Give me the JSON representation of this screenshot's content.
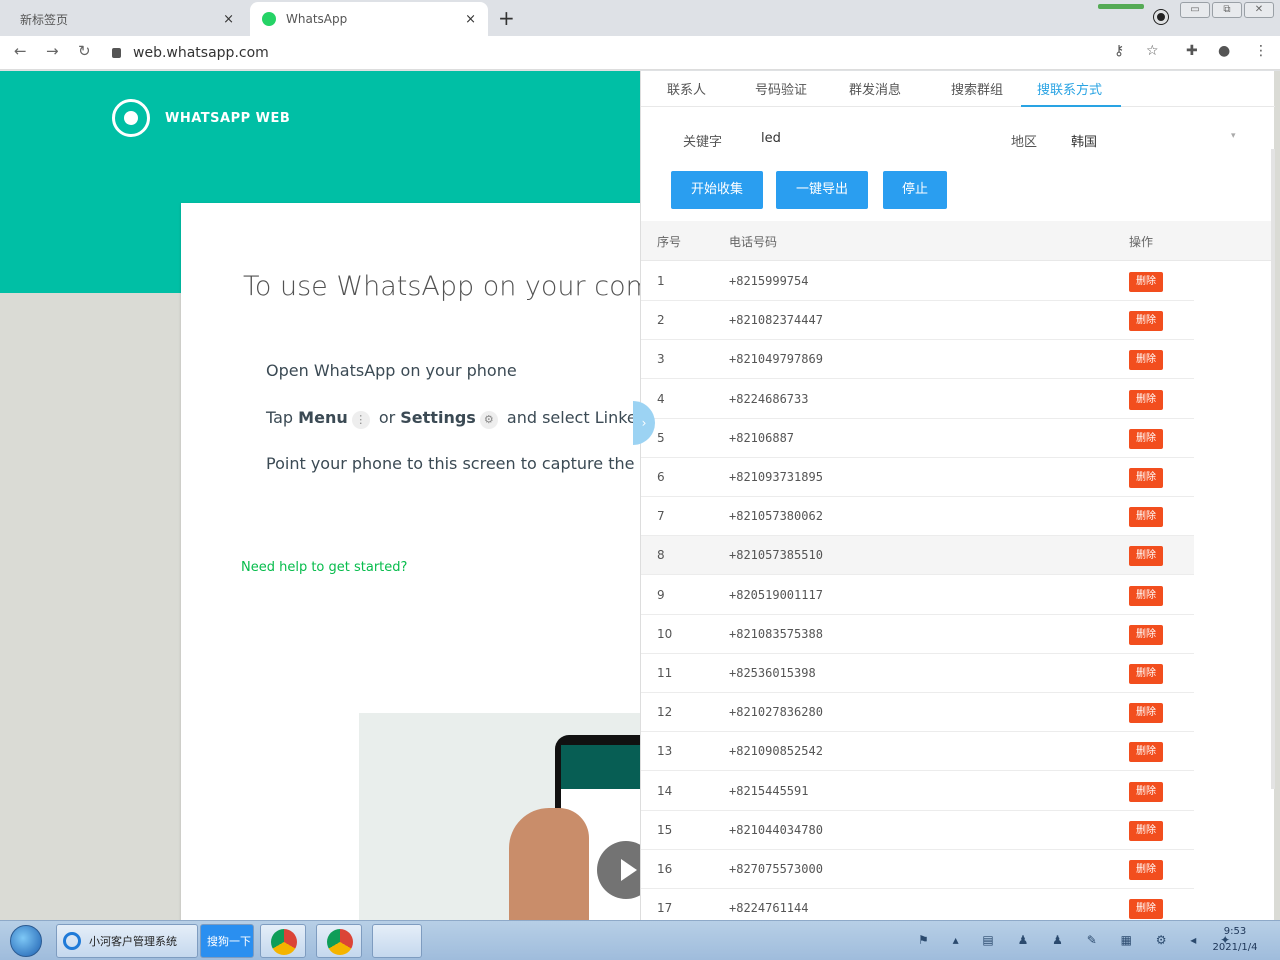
{
  "browser": {
    "tabs": [
      {
        "label": "新标签页",
        "close": "×"
      },
      {
        "label": "WhatsApp",
        "close": "×"
      }
    ],
    "new_tab": "+",
    "url": "web.whatsapp.com"
  },
  "whatsapp": {
    "brand": "WHATSAPP WEB",
    "title": "To use WhatsApp on your computer:",
    "step1": "Open WhatsApp on your phone",
    "step2_prefix": "Tap ",
    "step2_menu": "Menu",
    "step2_or": " or ",
    "step2_settings": "Settings",
    "step2_suffix": " and select Linked Devices",
    "step3": "Point your phone to this screen to capture the code",
    "help_link": "Need help to get started?"
  },
  "panel": {
    "tabs": [
      "联系人",
      "号码验证",
      "群发消息",
      "搜索群组",
      "搜联系方式"
    ],
    "active_tab": 4,
    "keyword_label": "关键字",
    "keyword_value": "led",
    "region_label": "地区",
    "region_value": "韩国",
    "buttons": [
      "开始收集",
      "一键导出",
      "停止"
    ],
    "columns": [
      "序号",
      "电话号码",
      "操作"
    ],
    "action_label": "删除",
    "highlight_row": 8,
    "rows": [
      {
        "idx": "1",
        "phone": "+8215999754"
      },
      {
        "idx": "2",
        "phone": "+821082374447"
      },
      {
        "idx": "3",
        "phone": "+821049797869"
      },
      {
        "idx": "4",
        "phone": "+8224686733"
      },
      {
        "idx": "5",
        "phone": "+82106887"
      },
      {
        "idx": "6",
        "phone": "+821093731895"
      },
      {
        "idx": "7",
        "phone": "+821057380062"
      },
      {
        "idx": "8",
        "phone": "+821057385510"
      },
      {
        "idx": "9",
        "phone": "+820519001117"
      },
      {
        "idx": "10",
        "phone": "+821083575388"
      },
      {
        "idx": "11",
        "phone": "+82536015398"
      },
      {
        "idx": "12",
        "phone": "+821027836280"
      },
      {
        "idx": "13",
        "phone": "+821090852542"
      },
      {
        "idx": "14",
        "phone": "+8215445591"
      },
      {
        "idx": "15",
        "phone": "+821044034780"
      },
      {
        "idx": "16",
        "phone": "+827075573000"
      },
      {
        "idx": "17",
        "phone": "+8224761144"
      }
    ]
  },
  "taskbar": {
    "apps": [
      "小河客户管理系统",
      "搜狗一下"
    ],
    "time": "9:53",
    "date": "2021/1/4"
  }
}
